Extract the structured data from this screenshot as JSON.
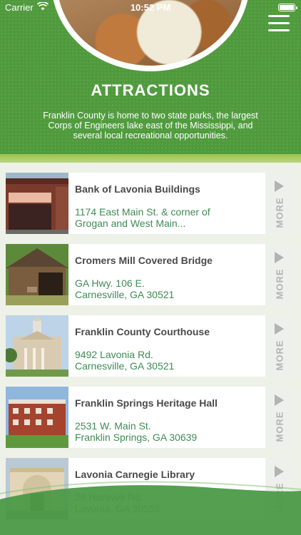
{
  "status_bar": {
    "carrier": "Carrier",
    "time": "10:52 PM"
  },
  "header": {
    "title": "ATTRACTIONS",
    "intro": "Franklin County is home to two state parks, the largest Corps of Engineers lake east of the Mississippi, and several local recreational opportunities."
  },
  "more_label": "MORE",
  "attractions": [
    {
      "name": "Bank of Lavonia Buildings",
      "address_line1": "1174 East Main St. & corner of",
      "address_line2": "Grogan and West Main..."
    },
    {
      "name": "Cromers Mill Covered Bridge",
      "address_line1": "GA Hwy. 106 E.",
      "address_line2": "Carnesville, GA 30521"
    },
    {
      "name": "Franklin County Courthouse",
      "address_line1": "9492 Lavonia Rd.",
      "address_line2": "Carnesville, GA 30521"
    },
    {
      "name": "Franklin Springs Heritage Hall",
      "address_line1": "2531 W. Main St.",
      "address_line2": "Franklin Springs, GA 30639"
    },
    {
      "name": "Lavonia Carnegie Library",
      "address_line1": "28 Hartwell Rd.",
      "address_line2": "Lavonia, GA 30553"
    }
  ],
  "colors": {
    "brand_green": "#4f9a3c",
    "address_green": "#3f8b55",
    "lime": "#9bc24a"
  }
}
